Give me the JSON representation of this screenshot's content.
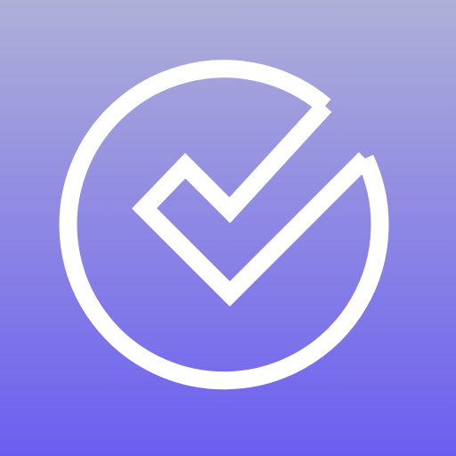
{
  "icon": {
    "name": "check-circle-icon",
    "gradient_top": "#aeb0d8",
    "gradient_bottom": "#6c5ef0",
    "glyph_color": "#ffffff"
  }
}
